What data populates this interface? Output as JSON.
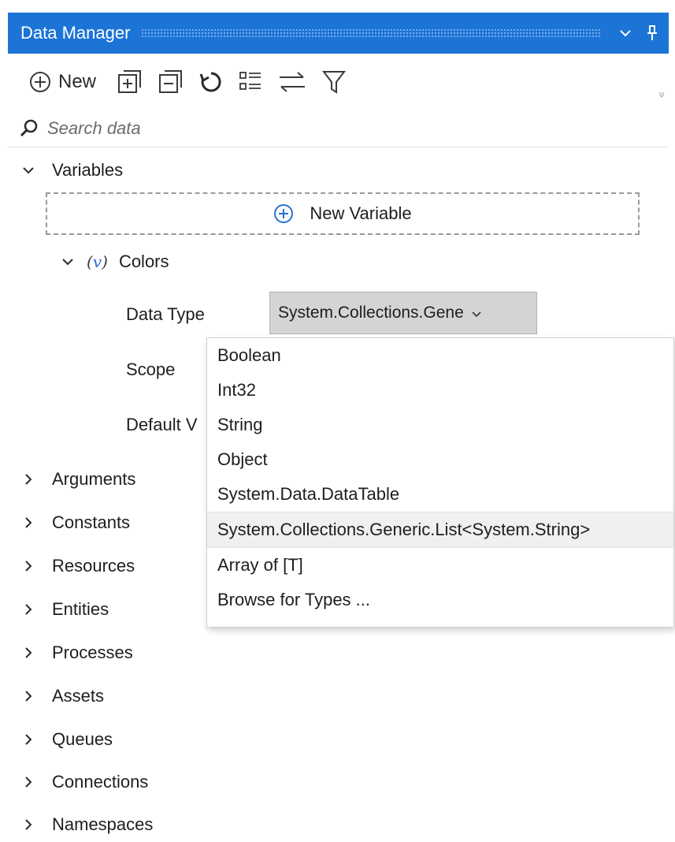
{
  "panel": {
    "title": "Data Manager",
    "accent_color": "#1c74d6",
    "title_buttons": [
      "chevron-down-icon",
      "pin-icon"
    ]
  },
  "toolbar": {
    "new_label": "New",
    "icons": [
      "plus-circle-icon",
      "expand-all-icon",
      "collapse-all-icon",
      "refresh-icon",
      "list-view-icon",
      "swap-icon",
      "filter-icon"
    ]
  },
  "search": {
    "placeholder": "Search data"
  },
  "variables": {
    "label": "Variables",
    "new_variable": "New Variable",
    "variable": {
      "glyph": "v",
      "name": "Colors",
      "data_type_label": "Data Type",
      "data_type_value": "System.Collections.Gene",
      "scope_label": "Scope",
      "default_label": "Default V"
    }
  },
  "type_options": [
    "Boolean",
    "Int32",
    "String",
    "Object",
    "System.Data.DataTable",
    "System.Collections.Generic.List<System.String>",
    "Array of [T]",
    "Browse for Types ..."
  ],
  "selected_option_index": 5,
  "sections": [
    "Arguments",
    "Constants",
    "Resources",
    "Entities",
    "Processes",
    "Assets",
    "Queues",
    "Connections",
    "Namespaces"
  ]
}
